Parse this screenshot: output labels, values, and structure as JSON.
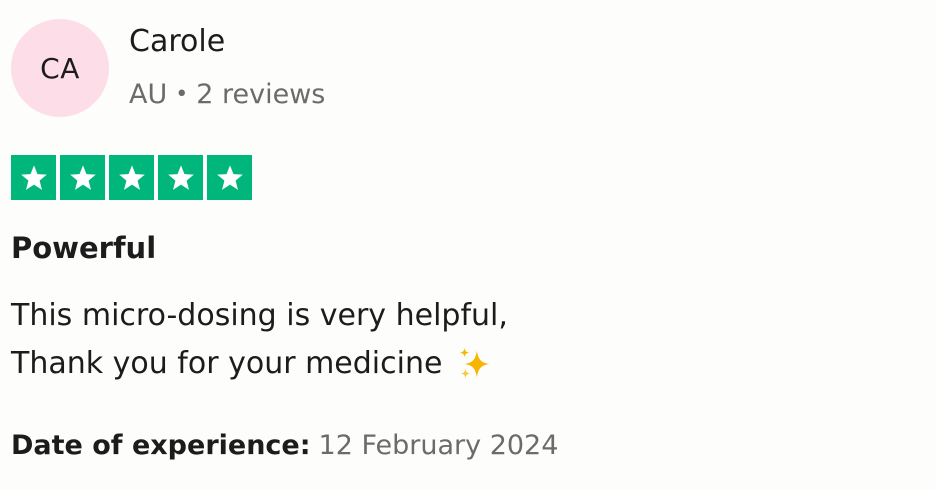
{
  "reviewer": {
    "initials": "CA",
    "name": "Carole",
    "country": "AU",
    "separator": "•",
    "review_count": "2 reviews",
    "avatar_color": "#fddde8"
  },
  "rating": {
    "stars": 5,
    "max": 5,
    "color": "#00b67a",
    "star_icon": "star-icon"
  },
  "review": {
    "title": "Powerful",
    "lines": [
      "This micro-dosing is very helpful,",
      "Thank you for your medicine"
    ],
    "emoji_icon": "sparkles-icon"
  },
  "experience": {
    "label": "Date of experience:",
    "date": "12 February 2024"
  }
}
